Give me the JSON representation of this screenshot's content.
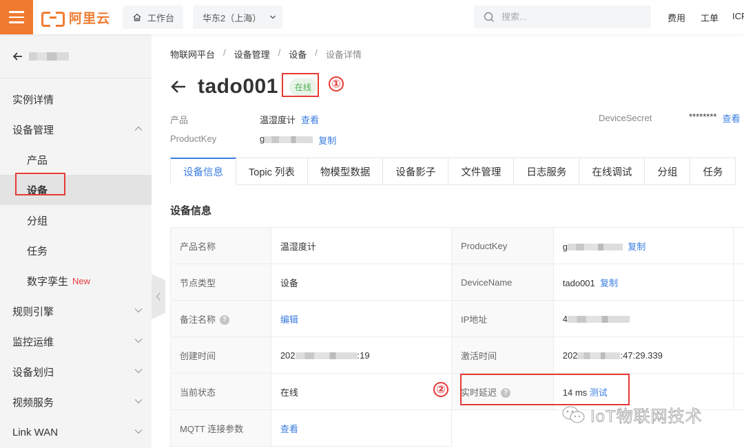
{
  "topbar": {
    "menu_icon": "hamburger-icon",
    "logo_text": "阿里云",
    "workbench_label": "工作台",
    "region_label": "华东2（上海）",
    "search_placeholder": "搜索...",
    "links": [
      "费用",
      "工单",
      "ICP"
    ]
  },
  "sidebar": {
    "back_label": "",
    "items": [
      {
        "label": "实例详情",
        "level": 1
      },
      {
        "label": "设备管理",
        "level": 1,
        "expanded": true
      },
      {
        "label": "产品",
        "level": 2
      },
      {
        "label": "设备",
        "level": 2,
        "active": true
      },
      {
        "label": "分组",
        "level": 2
      },
      {
        "label": "任务",
        "level": 2
      },
      {
        "label": "数字孪生",
        "level": 2,
        "badge": "New"
      },
      {
        "label": "规则引擎",
        "level": 1,
        "expanded": false
      },
      {
        "label": "监控运维",
        "level": 1,
        "expanded": false
      },
      {
        "label": "设备划归",
        "level": 1,
        "expanded": false
      },
      {
        "label": "视频服务",
        "level": 1,
        "expanded": false
      },
      {
        "label": "Link WAN",
        "level": 1,
        "expanded": false
      }
    ]
  },
  "breadcrumb": [
    "物联网平台",
    "设备管理",
    "设备",
    "设备详情"
  ],
  "device": {
    "name": "tado001",
    "status": "在线",
    "annotation_1": "①",
    "annotation_2": "②",
    "product_label": "产品",
    "product_value": "温湿度计",
    "product_link": "查看",
    "productkey_label": "ProductKey",
    "productkey_prefix": "g",
    "copy_link": "复制",
    "devicesecret_label": "DeviceSecret",
    "devicesecret_value": "********",
    "devicesecret_link": "查看"
  },
  "tabs": [
    "设备信息",
    "Topic 列表",
    "物模型数据",
    "设备影子",
    "文件管理",
    "日志服务",
    "在线调试",
    "分组",
    "任务"
  ],
  "active_tab": 0,
  "section_title": "设备信息",
  "info_rows": [
    {
      "l1": "产品名称",
      "v1": "温湿度计",
      "l2": "ProductKey",
      "v2": "g",
      "v2_link": "复制"
    },
    {
      "l1": "节点类型",
      "v1": "设备",
      "l2": "DeviceName",
      "v2": "tado001",
      "v2_link": "复制"
    },
    {
      "l1": "备注名称",
      "v1_link": "编辑",
      "l2": "IP地址",
      "v2": "4"
    },
    {
      "l1": "创建时间",
      "v1": "202",
      "v1_suffix": ":19",
      "l2": "激活时间",
      "v2": "202",
      "v2_suffix": ":47:29.339"
    },
    {
      "l1": "当前状态",
      "v1": "在线",
      "l2": "实时延迟",
      "v2": "14 ms",
      "v2_link": "测试"
    },
    {
      "l1": "MQTT 连接参数",
      "v1_link": "查看"
    }
  ],
  "watermark": "IoT物联网技术",
  "colors": {
    "brand": "#f07b30",
    "link": "#3a7de0",
    "online": "#4caf50",
    "annotation": "#e53935",
    "new_badge": "#e8373f"
  }
}
